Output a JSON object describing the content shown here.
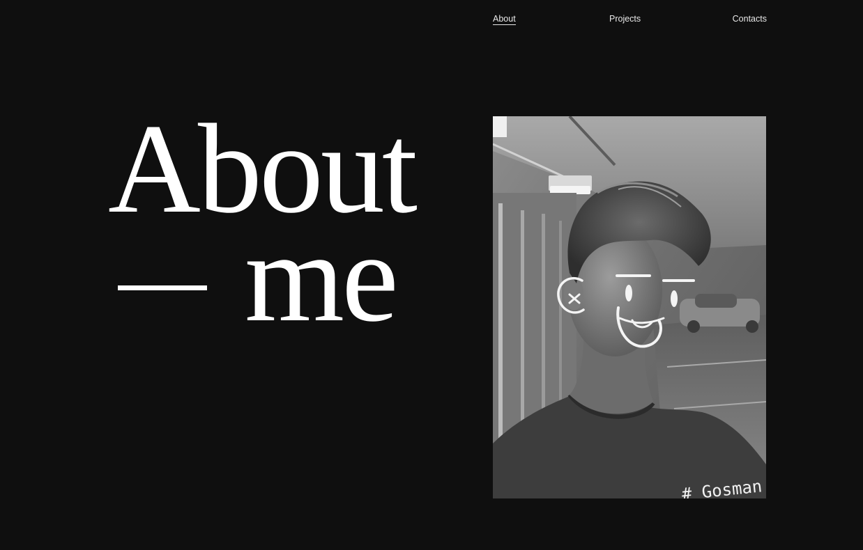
{
  "nav": {
    "items": [
      {
        "label": "About",
        "active": true
      },
      {
        "label": "Projects",
        "active": false
      },
      {
        "label": "Contacts",
        "active": false
      }
    ]
  },
  "hero": {
    "title_line1": "About",
    "title_line2": "me"
  },
  "photo": {
    "signature": "# Gosman"
  },
  "colors": {
    "background": "#0f0f0f",
    "text": "#ffffff",
    "nav_text": "#e9e9e9"
  }
}
